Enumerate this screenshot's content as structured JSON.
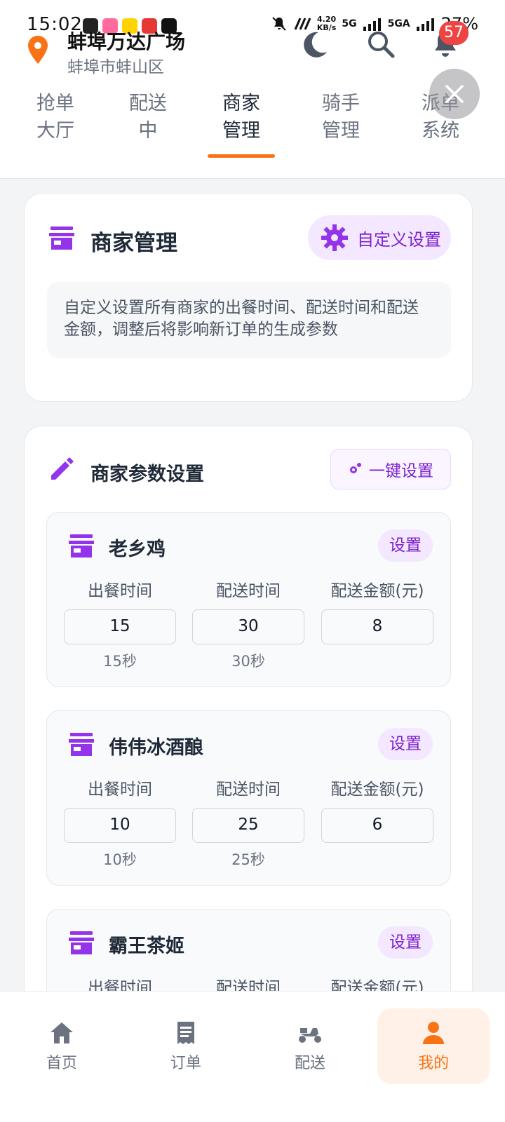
{
  "status_bar": {
    "time": "15:02",
    "net_speed_value": "4.20",
    "net_speed_unit": "KB/s",
    "sig1": "5G",
    "sig2": "5GA",
    "battery": "27%"
  },
  "header": {
    "location_name": "蚌埠万达广场",
    "location_sub": "蚌埠市蚌山区",
    "notification_count": "57"
  },
  "tabs": [
    {
      "line1": "抢单",
      "line2": "大厅"
    },
    {
      "line1": "配送",
      "line2": "中"
    },
    {
      "line1": "商家",
      "line2": "管理"
    },
    {
      "line1": "骑手",
      "line2": "管理"
    },
    {
      "line1": "派单",
      "line2": "系统"
    }
  ],
  "active_tab": "商家管理",
  "management_card": {
    "title": "商家管理",
    "custom_button": "自定义设置",
    "description": "自定义设置所有商家的出餐时间、配送时间和配送金额，调整后将影响新订单的生成参数"
  },
  "params_card": {
    "title": "商家参数设置",
    "one_key_button": "一键设置",
    "labels": {
      "prep": "出餐时间",
      "delivery": "配送时间",
      "fee": "配送金额(元)",
      "set": "设置"
    },
    "merchants": [
      {
        "name": "老乡鸡",
        "prep": "15",
        "delivery": "30",
        "fee": "8",
        "prep_hint": "15秒",
        "delivery_hint": "30秒"
      },
      {
        "name": "伟伟冰酒酿",
        "prep": "10",
        "delivery": "25",
        "fee": "6",
        "prep_hint": "10秒",
        "delivery_hint": "25秒"
      },
      {
        "name": "霸王茶姬",
        "prep": "",
        "delivery": "",
        "fee": "",
        "prep_hint": "",
        "delivery_hint": ""
      }
    ]
  },
  "bottom_nav": [
    {
      "label": "首页"
    },
    {
      "label": "订单"
    },
    {
      "label": "配送"
    },
    {
      "label": "我的"
    }
  ],
  "colors": {
    "accent_orange": "#f97316",
    "accent_purple": "#7e22ce",
    "purple_soft": "#f3e8ff",
    "badge_red": "#ef4444"
  }
}
